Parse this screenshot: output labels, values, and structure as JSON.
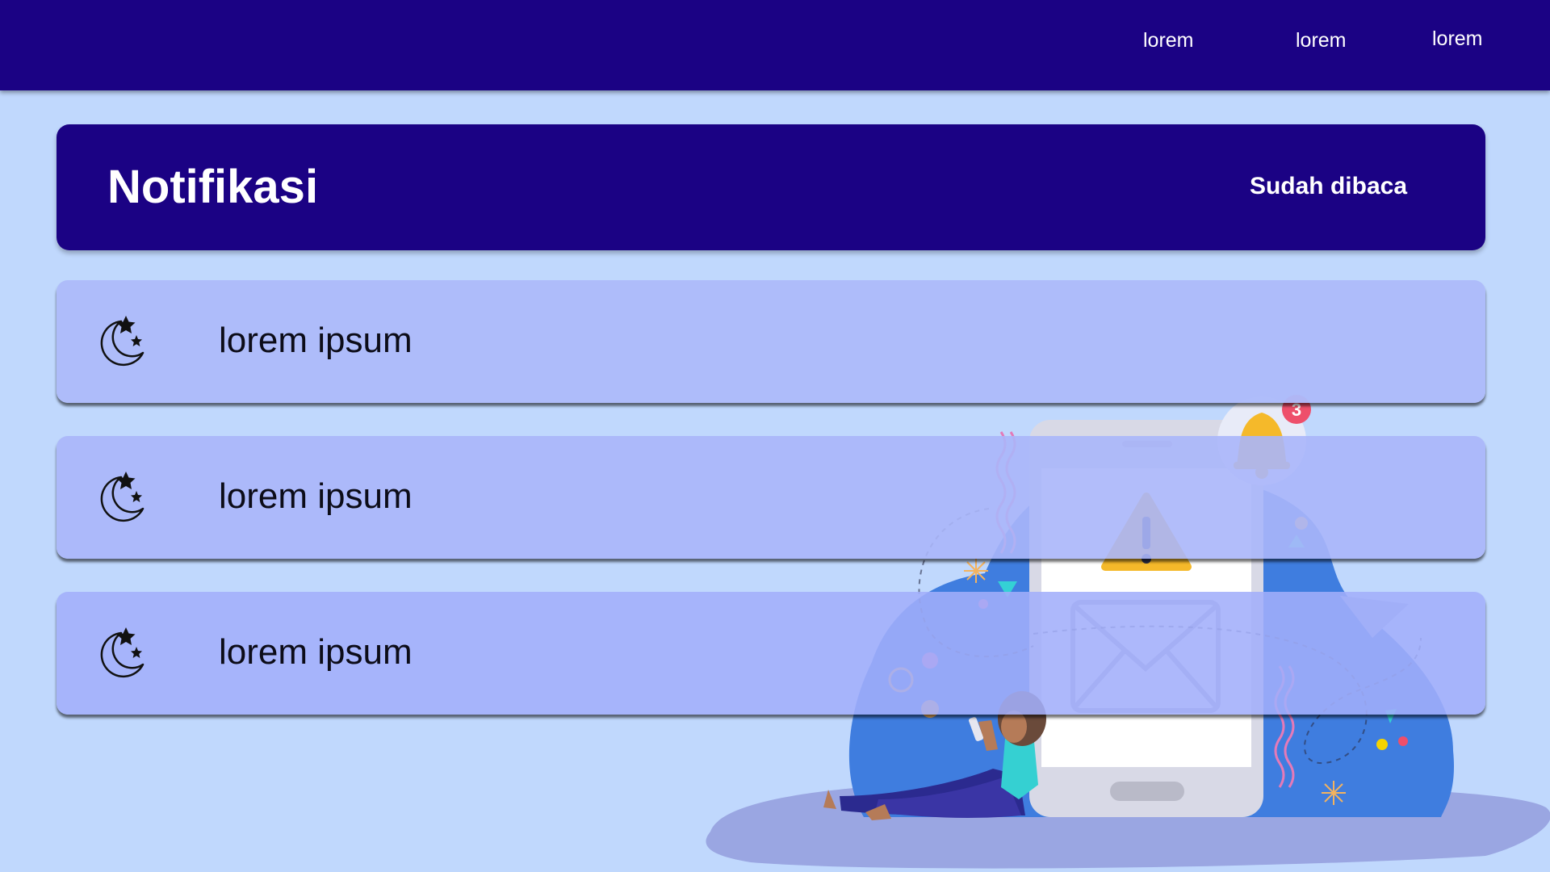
{
  "nav": {
    "links": [
      "lorem",
      "lorem",
      "lorem"
    ]
  },
  "header": {
    "title": "Notifikasi",
    "mark_read_label": "Sudah dibaca"
  },
  "notifications": [
    {
      "icon": "moon-stars-icon",
      "label": "lorem ipsum"
    },
    {
      "icon": "moon-stars-icon",
      "label": "lorem ipsum"
    },
    {
      "icon": "moon-stars-icon",
      "label": "lorem ipsum"
    }
  ],
  "illustration": {
    "badge_count": "3"
  },
  "colors": {
    "navy": "#1b0284",
    "background": "#c0d8fd",
    "card": "#adbafa"
  }
}
